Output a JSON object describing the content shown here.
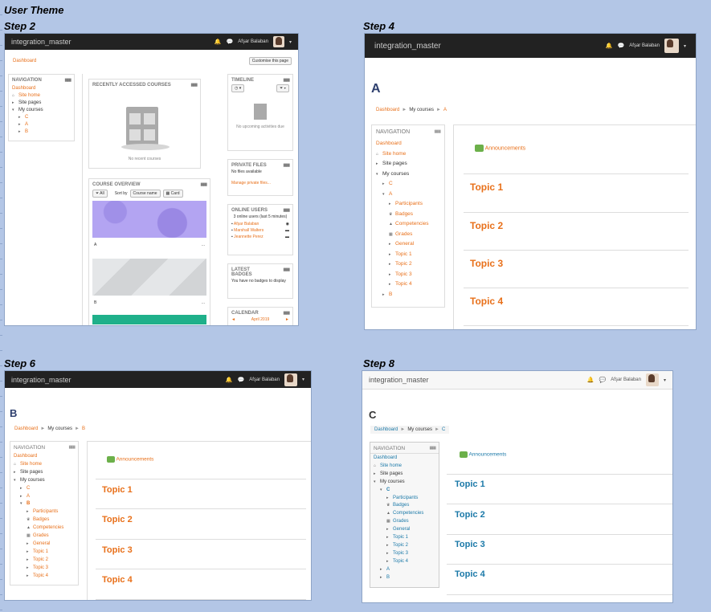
{
  "doc": {
    "title": "User Theme",
    "step2": "Step 2",
    "step4": "Step 4",
    "step6": "Step 6",
    "step8": "Step 8"
  },
  "app": {
    "site": "integration_master",
    "user": "Afşar Balaban"
  },
  "step2": {
    "crumb": "Dashboard",
    "customise": "Customise this page",
    "nav": {
      "title": "NAVIGATION",
      "items": [
        "Dashboard",
        "Site home",
        "Site pages",
        "My courses",
        "C",
        "A",
        "B"
      ]
    },
    "recent": {
      "title": "RECENTLY ACCESSED COURSES",
      "empty": "No recent courses"
    },
    "overview": {
      "title": "COURSE OVERVIEW",
      "filter": "All",
      "sort": "Sort by",
      "sortval": "Course name",
      "view": "Card",
      "c1": "A",
      "c2": "B",
      "more": "..."
    },
    "timeline": {
      "title": "TIMELINE",
      "empty": "No upcoming activities due"
    },
    "files": {
      "title": "PRIVATE FILES",
      "empty": "No files available",
      "manage": "Manage private files..."
    },
    "online": {
      "title": "ONLINE USERS",
      "summary": "3 online users (last 5 minutes)",
      "users": [
        "Afşar Balaban",
        "Marshall Walters",
        "Jeannette Perez"
      ]
    },
    "badges": {
      "title": "LATEST BADGES",
      "empty": "You have no badges to display"
    },
    "calendar": {
      "title": "CALENDAR",
      "month": "April 2019",
      "prev": "◄",
      "next": "►"
    }
  },
  "step4": {
    "heading": "A",
    "crumbs": [
      "Dashboard",
      "My courses",
      "A"
    ],
    "nav": {
      "title": "NAVIGATION",
      "items": [
        "Dashboard",
        "Site home",
        "Site pages",
        "My courses",
        "C",
        "A",
        "Participants",
        "Badges",
        "Competencies",
        "Grades",
        "General",
        "Topic 1",
        "Topic 2",
        "Topic 3",
        "Topic 4",
        "B"
      ]
    },
    "ann": "Announcements",
    "topics": [
      "Topic 1",
      "Topic 2",
      "Topic 3",
      "Topic 4"
    ]
  },
  "step6": {
    "heading": "B",
    "crumbs": [
      "Dashboard",
      "My courses",
      "B"
    ],
    "nav": {
      "title": "NAVIGATION",
      "items": [
        "Dashboard",
        "Site home",
        "Site pages",
        "My courses",
        "C",
        "A",
        "B",
        "Participants",
        "Badges",
        "Competencies",
        "Grades",
        "General",
        "Topic 1",
        "Topic 2",
        "Topic 3",
        "Topic 4"
      ]
    },
    "ann": "Announcements",
    "topics": [
      "Topic 1",
      "Topic 2",
      "Topic 3",
      "Topic 4"
    ]
  },
  "step8": {
    "heading": "C",
    "crumbs": [
      "Dashboard",
      "My courses",
      "C"
    ],
    "nav": {
      "title": "NAVIGATION",
      "items": [
        "Dashboard",
        "Site home",
        "Site pages",
        "My courses",
        "C",
        "Participants",
        "Badges",
        "Competencies",
        "Grades",
        "General",
        "Topic 1",
        "Topic 2",
        "Topic 3",
        "Topic 4",
        "A",
        "B"
      ]
    },
    "ann": "Announcements",
    "topics": [
      "Topic 1",
      "Topic 2",
      "Topic 3",
      "Topic 4"
    ]
  },
  "colors": {
    "orange": "#e8701a",
    "blue": "#1b79a8",
    "navbar": "#222222"
  }
}
